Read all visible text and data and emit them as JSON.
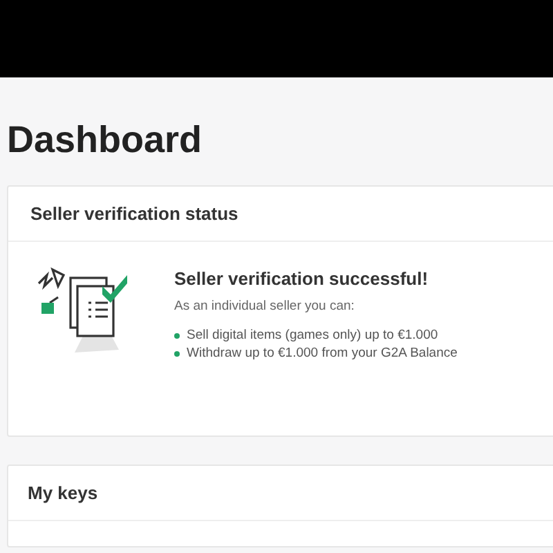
{
  "page_title": "Dashboard",
  "verification_card": {
    "title": "Seller verification status",
    "heading": "Seller verification successful!",
    "intro": "As an individual seller you can:",
    "benefits": [
      "Sell digital items (games only) up to €1.000",
      "Withdraw up to €1.000 from your G2A Balance"
    ]
  },
  "keys_card": {
    "title": "My keys"
  }
}
